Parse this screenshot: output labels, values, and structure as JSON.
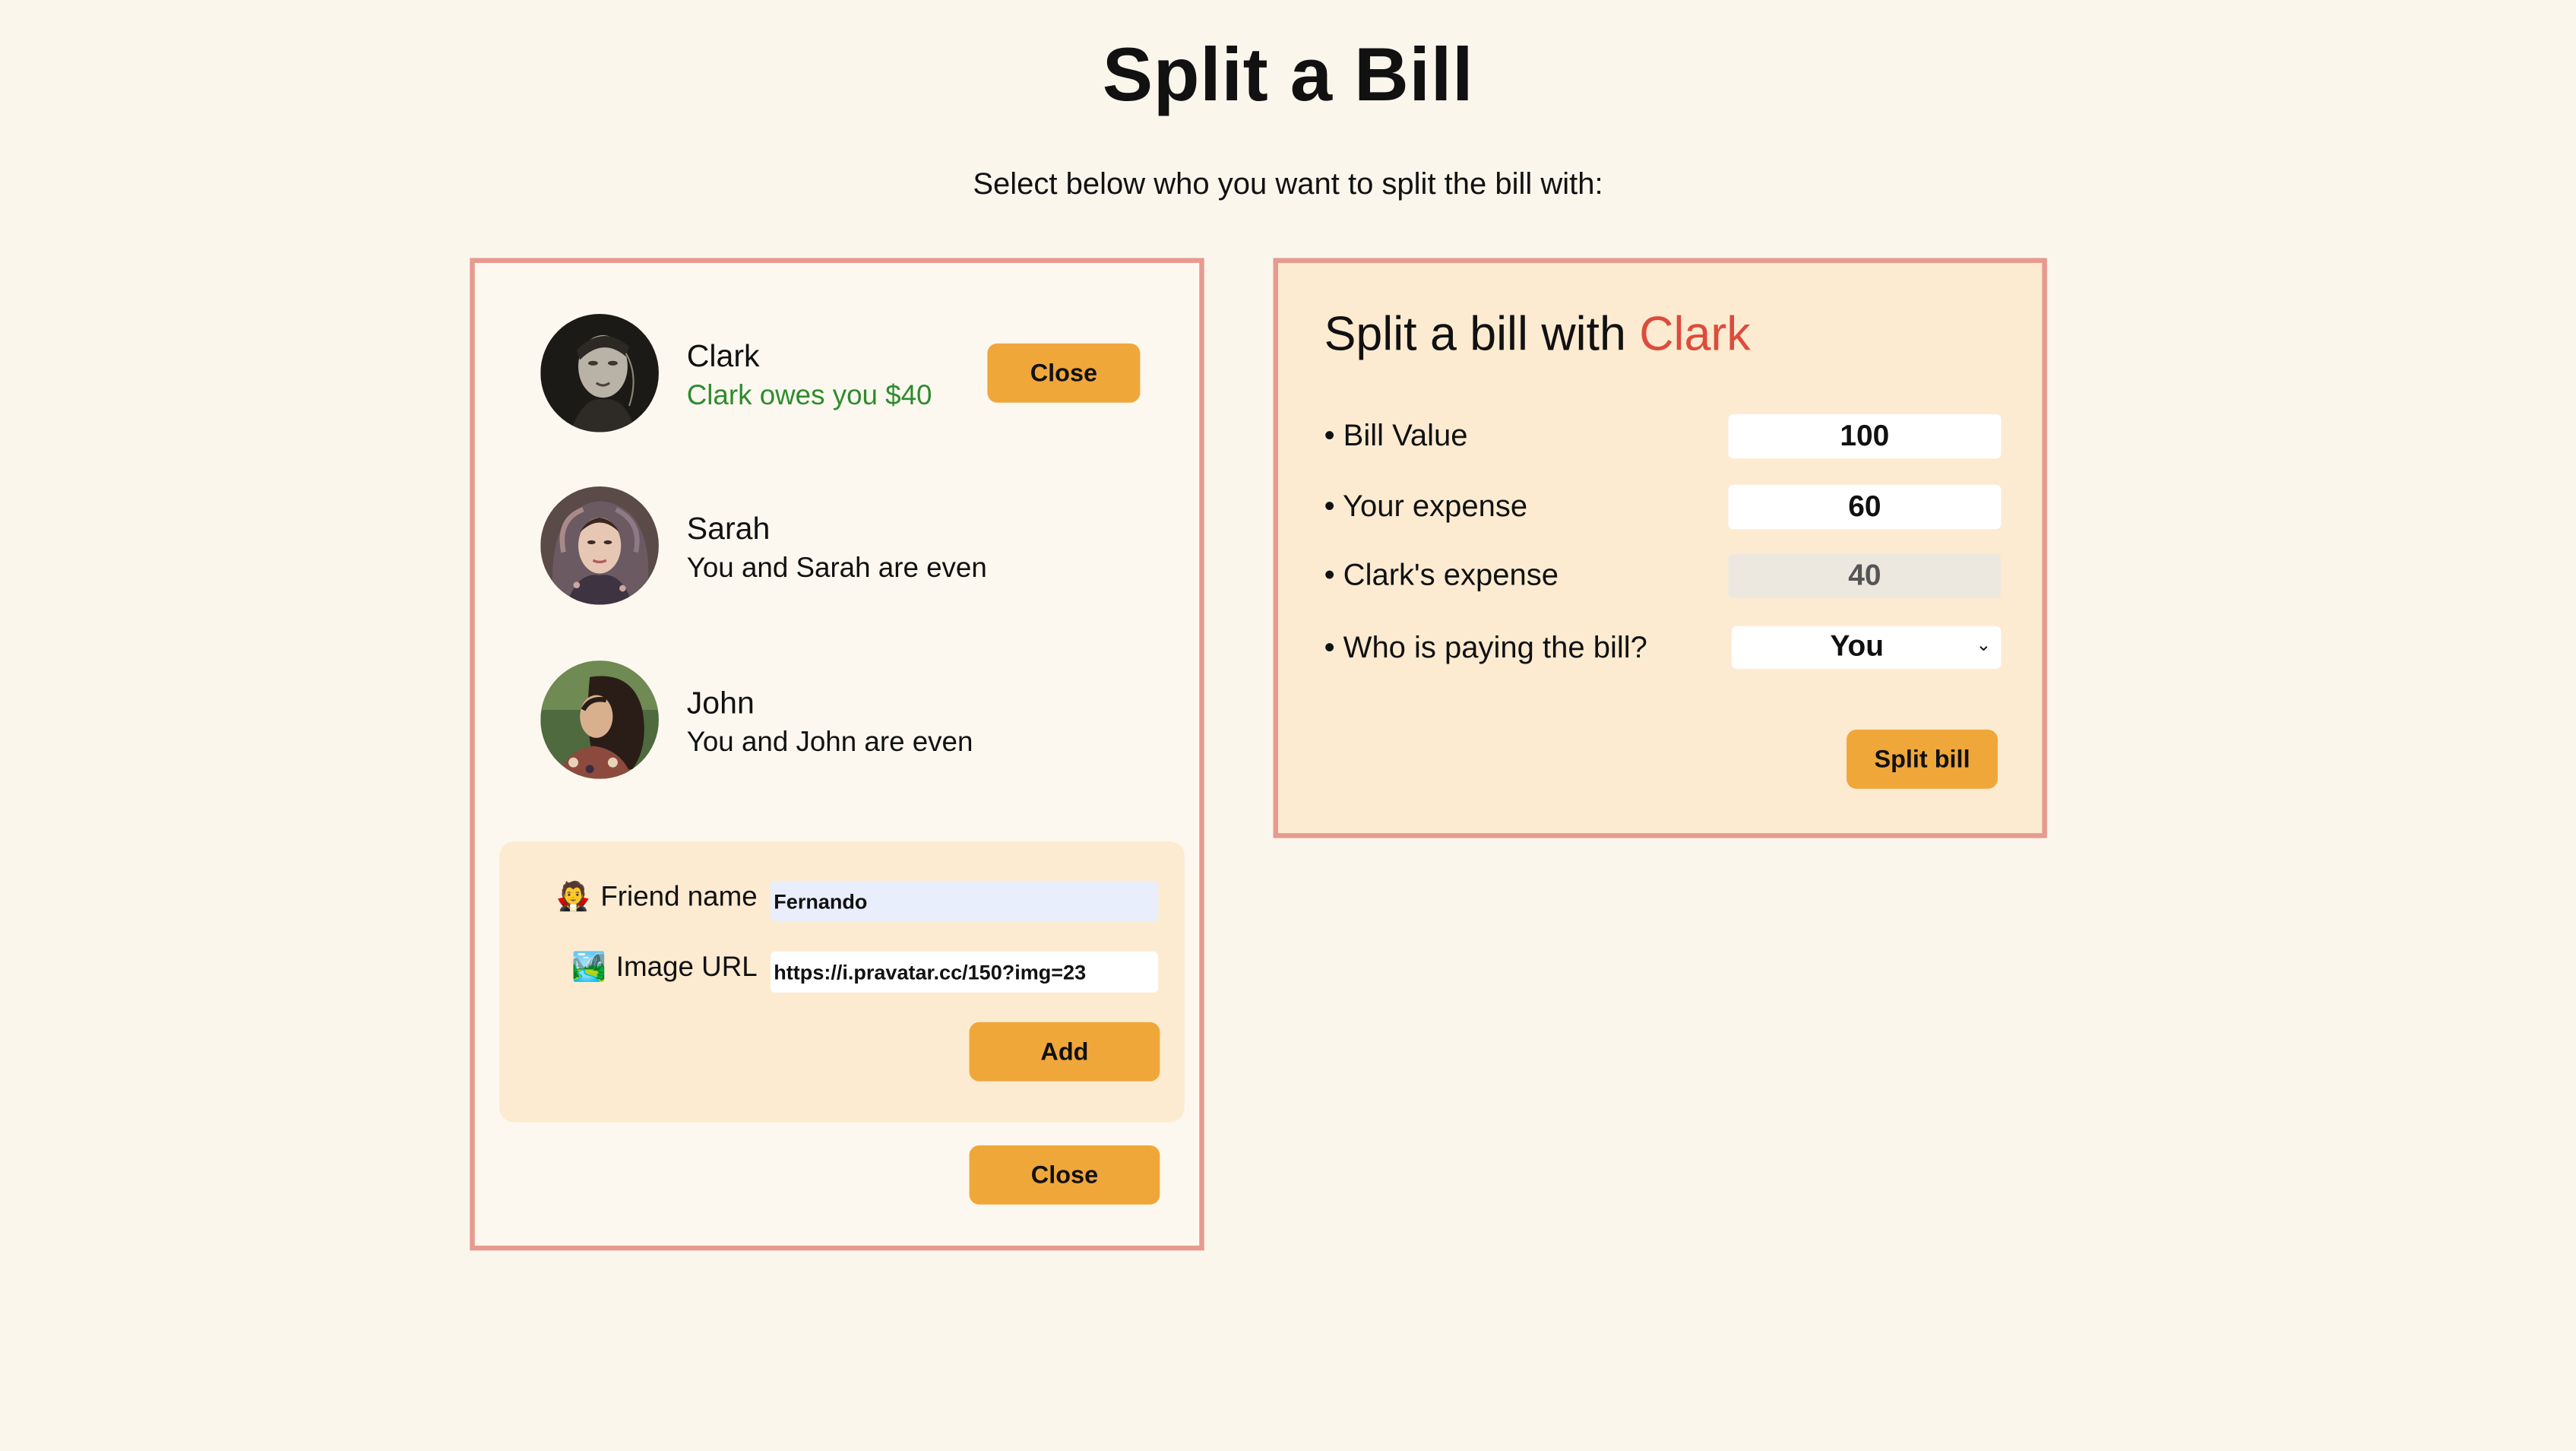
{
  "header": {
    "title": "Split a Bill",
    "subtitle": "Select below who you want to split the bill with:"
  },
  "friends": [
    {
      "name": "Clark",
      "status": "Clark owes you $40",
      "status_color": "#2e8b2e",
      "button_label": "Close"
    },
    {
      "name": "Sarah",
      "status": "You and Sarah are even"
    },
    {
      "name": "John",
      "status": "You and John are even"
    }
  ],
  "add_friend_form": {
    "name_icon": "🧛",
    "name_label": "Friend name",
    "name_value": "Fernando",
    "image_icon": "🏞️",
    "image_label": "Image URL",
    "image_value": "https://i.pravatar.cc/150?img=23",
    "add_label": "Add"
  },
  "close_form_label": "Close",
  "split_form": {
    "heading_prefix": "Split a bill with ",
    "heading_name": "Clark",
    "bill_value_label": "• Bill Value",
    "bill_value": "100",
    "your_expense_label": "• Your expense",
    "your_expense": "60",
    "friend_expense_label": "• Clark's expense",
    "friend_expense": "40",
    "payer_label": "• Who is paying the bill?",
    "payer_value": "You",
    "split_label": "Split bill"
  },
  "colors": {
    "background": "#fbf6ec",
    "panel_border": "#e79a8f",
    "accent_button": "#f0a73a",
    "form_background": "#fcebd1",
    "highlight_name": "#dd4c3b",
    "owes_text": "#2e8b2e"
  }
}
